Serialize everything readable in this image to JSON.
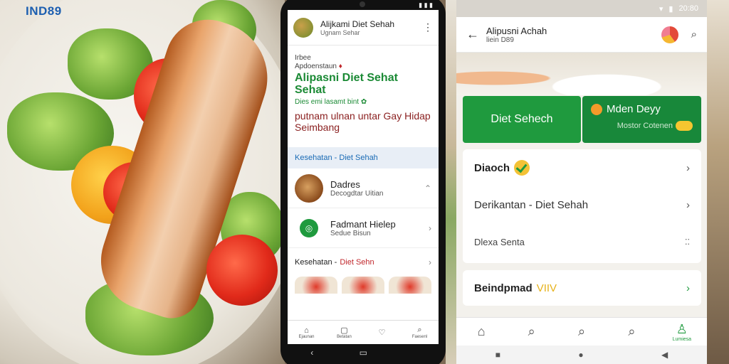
{
  "brand": "IND89",
  "phone": {
    "app_title": "Alijkami Diet Sehah",
    "app_subtitle": "Ugnam Sehar",
    "label_small1": "Irbee",
    "label_small2": "Apdoenstaun",
    "hero_title": "Alipasni Diet Sehat Sehat",
    "hero_note": "Dies emi lasamt bint",
    "hero_desc": "putnam ulnan untar Gay Hidap Seimbang",
    "section_chip": "Kesehatan - Diet Sehah",
    "rows": [
      {
        "title": "Dadres",
        "subtitle": "Decogdtar Uitian"
      },
      {
        "title": "Fadmant Hielep",
        "subtitle": "Sedue Bisun"
      }
    ],
    "row3_label": "Kesehatan - ",
    "row3_red": "Diet Sehn",
    "nav": [
      "Ejaunan",
      "Betatan",
      "",
      "Faesenl"
    ]
  },
  "right": {
    "status_time": "20:80",
    "app_title": "Alipusni Achah",
    "app_subtitle": "liein D89",
    "card1": "Diet Sehech",
    "card2_title": "Mden Deyy",
    "card2_sub": "Mostor Cotenen",
    "list": [
      {
        "text": "Diaoch"
      },
      {
        "text": "Derikantan - Diet Sehah"
      },
      {
        "text": "Dlexa Senta"
      }
    ],
    "card3_title": "Beindpmad",
    "card3_accent": "VIIV",
    "nav_label": "Lumiesa"
  }
}
